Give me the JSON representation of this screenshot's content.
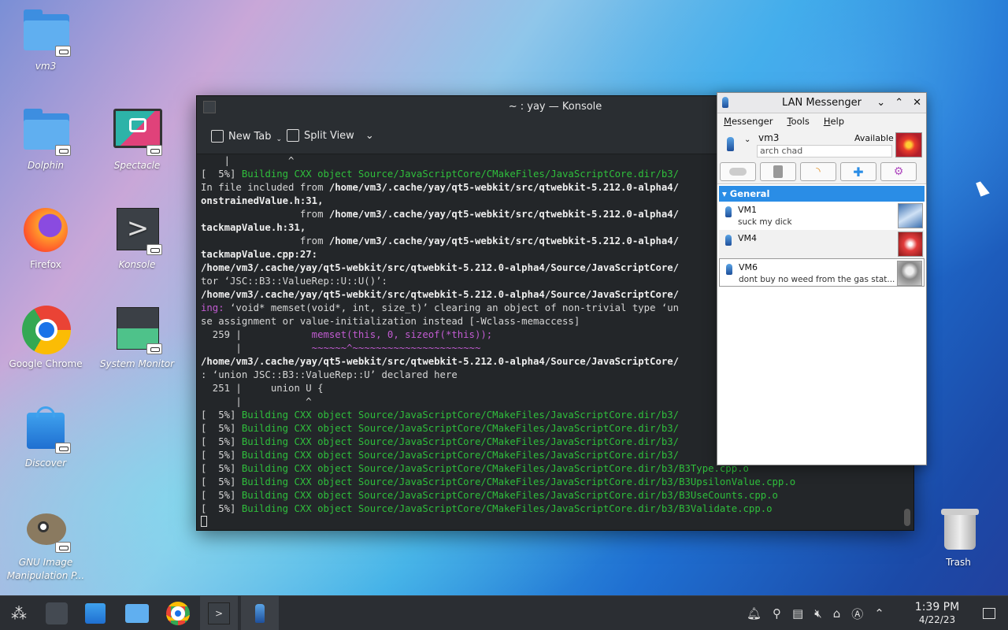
{
  "desktop": {
    "icons": [
      {
        "label": "vm3"
      },
      {
        "label": "Dolphin"
      },
      {
        "label": "Spectacle"
      },
      {
        "label": "Firefox"
      },
      {
        "label": "Konsole"
      },
      {
        "label": "Google Chrome"
      },
      {
        "label": "System Monitor"
      },
      {
        "label": "Discover"
      },
      {
        "label": "GNU Image Manipulation P..."
      },
      {
        "label": "Trash"
      }
    ]
  },
  "konsole": {
    "title": "~ : yay — Konsole",
    "new_tab": "New Tab",
    "split_view": "Split View",
    "lines": [
      "    |          ^",
      "[  5%] Building CXX object Source/JavaScriptCore/CMakeFiles/JavaScriptCore.dir/b3/",
      "In file included from /home/vm3/.cache/yay/qt5-webkit/src/qtwebkit-5.212.0-alpha4/",
      "onstrainedValue.h:31,",
      "                 from /home/vm3/.cache/yay/qt5-webkit/src/qtwebkit-5.212.0-alpha4/",
      "tackmapValue.h:31,",
      "                 from /home/vm3/.cache/yay/qt5-webkit/src/qtwebkit-5.212.0-alpha4/",
      "tackmapValue.cpp:27:",
      "/home/vm3/.cache/yay/qt5-webkit/src/qtwebkit-5.212.0-alpha4/Source/JavaScriptCore/",
      "tor ‘JSC::B3::ValueRep::U::U()’:",
      "/home/vm3/.cache/yay/qt5-webkit/src/qtwebkit-5.212.0-alpha4/Source/JavaScriptCore/",
      "ing: ‘void* memset(void*, int, size_t)’ clearing an object of non-trivial type ‘un",
      "se assignment or value-initialization instead [-Wclass-memaccess]",
      "  259 |            memset(this, 0, sizeof(*this));",
      "      |            ~~~~~~^~~~~~~~~~~~~~~~~~~~~~~",
      "/home/vm3/.cache/yay/qt5-webkit/src/qtwebkit-5.212.0-alpha4/Source/JavaScriptCore/",
      ": ‘union JSC::B3::ValueRep::U’ declared here",
      "  251 |     union U {",
      "      |           ^",
      "[  5%] Building CXX object Source/JavaScriptCore/CMakeFiles/JavaScriptCore.dir/b3/",
      "[  5%] Building CXX object Source/JavaScriptCore/CMakeFiles/JavaScriptCore.dir/b3/",
      "[  5%] Building CXX object Source/JavaScriptCore/CMakeFiles/JavaScriptCore.dir/b3/",
      "[  5%] Building CXX object Source/JavaScriptCore/CMakeFiles/JavaScriptCore.dir/b3/",
      "[  5%] Building CXX object Source/JavaScriptCore/CMakeFiles/JavaScriptCore.dir/b3/B3Type.cpp.o",
      "[  5%] Building CXX object Source/JavaScriptCore/CMakeFiles/JavaScriptCore.dir/b3/B3UpsilonValue.cpp.o",
      "[  5%] Building CXX object Source/JavaScriptCore/CMakeFiles/JavaScriptCore.dir/b3/B3UseCounts.cpp.o",
      "[  5%] Building CXX object Source/JavaScriptCore/CMakeFiles/JavaScriptCore.dir/b3/B3Validate.cpp.o"
    ]
  },
  "lan": {
    "title": "LAN Messenger",
    "menu": [
      "Messenger",
      "Tools",
      "Help"
    ],
    "user": {
      "name": "vm3",
      "status": "Available",
      "note": "arch chad"
    },
    "group": "General",
    "contacts": [
      {
        "name": "VM1",
        "message": "suck my dick"
      },
      {
        "name": "VM4",
        "message": ""
      },
      {
        "name": "VM6",
        "message": "dont buy no weed from the gas stat..."
      }
    ]
  },
  "clock": {
    "time": "1:39 PM",
    "date": "4/22/23"
  },
  "colors": {
    "accent": "#2a8de6",
    "build_green": "#2fbf3c",
    "warning_magenta": "#c15bd1"
  }
}
